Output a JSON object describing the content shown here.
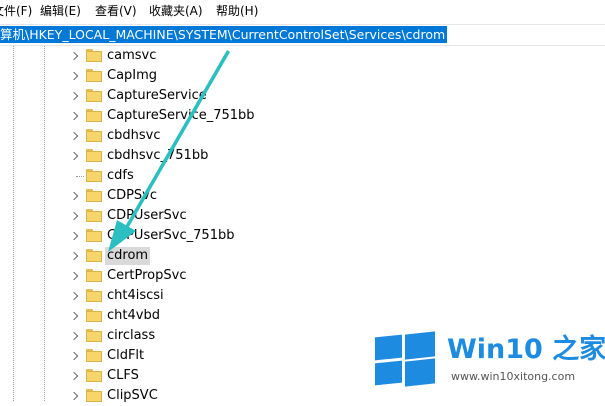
{
  "menu": [
    {
      "label": "文件(F)"
    },
    {
      "label": "编辑(E)"
    },
    {
      "label": "查看(V)"
    },
    {
      "label": "收藏夹(A)"
    },
    {
      "label": "帮助(H)"
    }
  ],
  "address": {
    "path": "算机\\HKEY_LOCAL_MACHINE\\SYSTEM\\CurrentControlSet\\Services\\cdrom"
  },
  "tree": {
    "items": [
      {
        "label": "camsvc",
        "expandable": true
      },
      {
        "label": "CapImg",
        "expandable": true
      },
      {
        "label": "CaptureService",
        "expandable": true
      },
      {
        "label": "CaptureService_751bb",
        "expandable": true
      },
      {
        "label": "cbdhsvc",
        "expandable": true
      },
      {
        "label": "cbdhsvc_751bb",
        "expandable": true
      },
      {
        "label": "cdfs",
        "expandable": false
      },
      {
        "label": "CDPSvc",
        "expandable": true
      },
      {
        "label": "CDPUserSvc",
        "expandable": true
      },
      {
        "label": "CDPUserSvc_751bb",
        "expandable": true
      },
      {
        "label": "cdrom",
        "expandable": true,
        "selected": true
      },
      {
        "label": "CertPropSvc",
        "expandable": true
      },
      {
        "label": "cht4iscsi",
        "expandable": true
      },
      {
        "label": "cht4vbd",
        "expandable": true
      },
      {
        "label": "circlass",
        "expandable": true
      },
      {
        "label": "CldFlt",
        "expandable": true
      },
      {
        "label": "CLFS",
        "expandable": true
      },
      {
        "label": "ClipSVC",
        "expandable": true
      }
    ]
  },
  "colors": {
    "address_highlight": "#0078d7",
    "selection": "#d9d9d9",
    "folder": "#f8d56b",
    "arrow": "#2bbfc1",
    "logo": "#1d8ce0"
  },
  "logo": {
    "brand": "Win10 之家",
    "url": "www.win10xitong.com",
    "icon": "windows-logo-icon"
  }
}
